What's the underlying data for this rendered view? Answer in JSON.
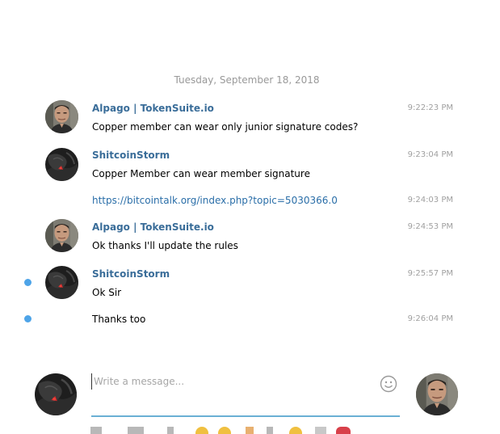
{
  "chat": {
    "date_separator": "Tuesday, September 18, 2018",
    "messages": [
      {
        "sender": "Alpago | TokenSuite.io",
        "text": "Copper member can wear only junior signature codes?",
        "time": "9:22:23 PM"
      },
      {
        "sender": "ShitcoinStorm",
        "text": "Copper Member can wear member signature",
        "time": "9:23:04 PM"
      },
      {
        "text": "https://bitcointalk.org/index.php?topic=5030366.0",
        "time": "9:24:03 PM"
      },
      {
        "sender": "Alpago | TokenSuite.io",
        "text": "Ok thanks I'll update the rules",
        "time": "9:24:53 PM"
      },
      {
        "sender": "ShitcoinStorm",
        "text": "Ok Sir",
        "time": "9:25:57 PM"
      },
      {
        "text": "Thanks too",
        "time": "9:26:04 PM"
      }
    ]
  },
  "composer": {
    "placeholder": "Write a message...",
    "value": ""
  },
  "icons": {
    "emoji": "smiley-icon",
    "avatars": [
      "alpago-avatar",
      "shitcoinstorm-avatar"
    ]
  },
  "colors": {
    "sender_name": "#3a6d99",
    "link": "#2a6ea8",
    "unread_dot": "#4ea4e8",
    "composer_underline": "#6ab0d4",
    "timestamp": "#a0a0a0"
  }
}
